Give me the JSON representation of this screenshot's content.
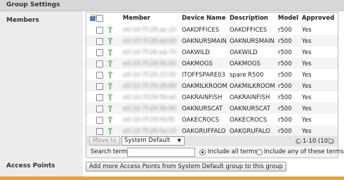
{
  "section_title": "Group Settings",
  "labels": {
    "members": "Members",
    "access_points": "Access Points"
  },
  "table": {
    "columns": [
      "Member",
      "Device Name",
      "Description",
      "Model",
      "Approved"
    ],
    "rows": [
      {
        "member": "e0:10:7f:28:ae:20",
        "device": "OAKOFFICES",
        "desc": "OAKOFFICES",
        "model": "r500",
        "approved": "Yes"
      },
      {
        "member": "e0:10:7f:28:ad:40",
        "device": "OAKNURSMAIN",
        "desc": "OAKNURSMAIN",
        "model": "r500",
        "approved": "Yes"
      },
      {
        "member": "e0:10:7f:28:ad:70",
        "device": "OAKWILD",
        "desc": "OAKWILD",
        "model": "r500",
        "approved": "Yes"
      },
      {
        "member": "e0:10:7f:29:5b:00",
        "device": "OAKMOGS",
        "desc": "OAKMOGS",
        "model": "r500",
        "approved": "Yes"
      },
      {
        "member": "e0:10:7f:29:22:00",
        "device": "ITOFFSPARE03",
        "desc": "spare R500",
        "model": "r500",
        "approved": "Yes"
      },
      {
        "member": "e0:10:7f:29:26:60",
        "device": "OAKMILKROOM",
        "desc": "OAKMILKROOM",
        "model": "r500",
        "approved": "Yes"
      },
      {
        "member": "e0:10:7f:29:59:a0",
        "device": "OAKRAINFISH",
        "desc": "OAKRAINFISH",
        "model": "r500",
        "approved": "Yes"
      },
      {
        "member": "e0:10:7f:29:5b:90",
        "device": "OAKNURSCAT",
        "desc": "OAKNURSCAT",
        "model": "r500",
        "approved": "Yes"
      },
      {
        "member": "e0:10:7f:29:59:f0",
        "device": "OAKECROCS",
        "desc": "OAKECROCS",
        "model": "r500",
        "approved": "Yes"
      },
      {
        "member": "e0:10:7f:29:5a:10",
        "device": "OAKGRUFFALO",
        "desc": "OAKGRUFALO",
        "model": "r500",
        "approved": "Yes"
      }
    ]
  },
  "move_to_label": "Move to",
  "move_target": "System Default",
  "pagination": "1-10 (10)",
  "search_label": "Search terms",
  "search_value": "",
  "radio_all": "Include all terms",
  "radio_any": "Include any of these terms",
  "add_ap_button": "Add more Access Points from System Default group to this group",
  "colors": {
    "accent_bar": "#f5a11c",
    "ap_icon": "#3aa13a"
  }
}
